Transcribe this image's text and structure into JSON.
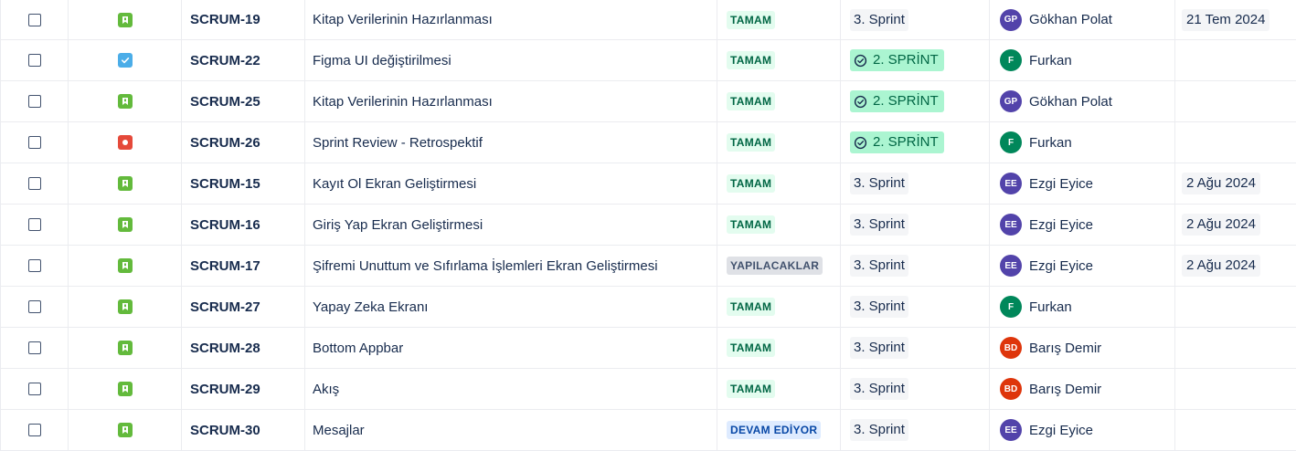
{
  "colors": {
    "story": "#63ba3c",
    "task": "#4bade8",
    "bug": "#e5493a",
    "done_status_bg": "#e3fcef",
    "done_sprint_bg": "#abf5d1"
  },
  "rows": [
    {
      "type": "story",
      "type_icon": "bookmark-icon",
      "key": "SCRUM-19",
      "summary": "Kitap Verilerinin Hazırlanması",
      "status": "TAMAM",
      "status_kind": "done",
      "sprint": "3. Sprint",
      "sprint_done": false,
      "assignee_initials": "GP",
      "assignee": "Gökhan Polat",
      "avatar_kind": "gp",
      "due": "21 Tem 2024"
    },
    {
      "type": "task",
      "type_icon": "checkmark-icon",
      "key": "SCRUM-22",
      "summary": "Figma UI değiştirilmesi",
      "status": "TAMAM",
      "status_kind": "done",
      "sprint": "2. SPRİNT",
      "sprint_done": true,
      "assignee_initials": "F",
      "assignee": "Furkan",
      "avatar_kind": "f",
      "due": ""
    },
    {
      "type": "story",
      "type_icon": "bookmark-icon",
      "key": "SCRUM-25",
      "summary": "Kitap Verilerinin Hazırlanması",
      "status": "TAMAM",
      "status_kind": "done",
      "sprint": "2. SPRİNT",
      "sprint_done": true,
      "assignee_initials": "GP",
      "assignee": "Gökhan Polat",
      "avatar_kind": "gp",
      "due": ""
    },
    {
      "type": "bug",
      "type_icon": "bug-dot-icon",
      "key": "SCRUM-26",
      "summary": "Sprint Review - Retrospektif",
      "status": "TAMAM",
      "status_kind": "done",
      "sprint": "2. SPRİNT",
      "sprint_done": true,
      "assignee_initials": "F",
      "assignee": "Furkan",
      "avatar_kind": "f",
      "due": ""
    },
    {
      "type": "story",
      "type_icon": "bookmark-icon",
      "key": "SCRUM-15",
      "summary": "Kayıt Ol Ekran Geliştirmesi",
      "status": "TAMAM",
      "status_kind": "done",
      "sprint": "3. Sprint",
      "sprint_done": false,
      "assignee_initials": "EE",
      "assignee": "Ezgi Eyice",
      "avatar_kind": "ee",
      "due": "2 Ağu 2024"
    },
    {
      "type": "story",
      "type_icon": "bookmark-icon",
      "key": "SCRUM-16",
      "summary": "Giriş Yap Ekran Geliştirmesi",
      "status": "TAMAM",
      "status_kind": "done",
      "sprint": "3. Sprint",
      "sprint_done": false,
      "assignee_initials": "EE",
      "assignee": "Ezgi Eyice",
      "avatar_kind": "ee",
      "due": "2 Ağu 2024"
    },
    {
      "type": "story",
      "type_icon": "bookmark-icon",
      "key": "SCRUM-17",
      "summary": "Şifremi Unuttum ve Sıfırlama İşlemleri Ekran Geliştirmesi",
      "status": "YAPILACAKLAR",
      "status_kind": "todo",
      "sprint": "3. Sprint",
      "sprint_done": false,
      "assignee_initials": "EE",
      "assignee": "Ezgi Eyice",
      "avatar_kind": "ee",
      "due": "2 Ağu 2024"
    },
    {
      "type": "story",
      "type_icon": "bookmark-icon",
      "key": "SCRUM-27",
      "summary": "Yapay Zeka Ekranı",
      "status": "TAMAM",
      "status_kind": "done",
      "sprint": "3. Sprint",
      "sprint_done": false,
      "assignee_initials": "F",
      "assignee": "Furkan",
      "avatar_kind": "f",
      "due": ""
    },
    {
      "type": "story",
      "type_icon": "bookmark-icon",
      "key": "SCRUM-28",
      "summary": "Bottom Appbar",
      "status": "TAMAM",
      "status_kind": "done",
      "sprint": "3. Sprint",
      "sprint_done": false,
      "assignee_initials": "BD",
      "assignee": "Barış Demir",
      "avatar_kind": "bd",
      "due": ""
    },
    {
      "type": "story",
      "type_icon": "bookmark-icon",
      "key": "SCRUM-29",
      "summary": "Akış",
      "status": "TAMAM",
      "status_kind": "done",
      "sprint": "3. Sprint",
      "sprint_done": false,
      "assignee_initials": "BD",
      "assignee": "Barış Demir",
      "avatar_kind": "bd",
      "due": ""
    },
    {
      "type": "story",
      "type_icon": "bookmark-icon",
      "key": "SCRUM-30",
      "summary": "Mesajlar",
      "status": "DEVAM EDİYOR",
      "status_kind": "prog",
      "sprint": "3. Sprint",
      "sprint_done": false,
      "assignee_initials": "EE",
      "assignee": "Ezgi Eyice",
      "avatar_kind": "ee",
      "due": ""
    }
  ]
}
